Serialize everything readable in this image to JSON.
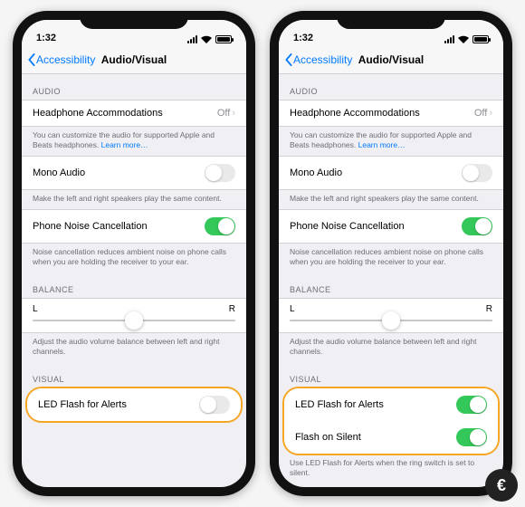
{
  "status": {
    "time": "1:32"
  },
  "nav": {
    "back": "Accessibility",
    "title": "Audio/Visual"
  },
  "sections": {
    "audio_header": "AUDIO",
    "visual_header": "VISUAL",
    "balance_header": "BALANCE"
  },
  "rows": {
    "headphone": {
      "label": "Headphone Accommodations",
      "value": "Off"
    },
    "mono": {
      "label": "Mono Audio"
    },
    "noise": {
      "label": "Phone Noise Cancellation"
    },
    "led": {
      "label": "LED Flash for Alerts"
    },
    "flash_silent": {
      "label": "Flash on Silent"
    }
  },
  "footers": {
    "headphone": "You can customize the audio for supported Apple and Beats headphones. ",
    "headphone_link": "Learn more…",
    "mono": "Make the left and right speakers play the same content.",
    "noise": "Noise cancellation reduces ambient noise on phone calls when you are holding the receiver to your ear.",
    "balance": "Adjust the audio volume balance between left and right channels.",
    "led": "Use LED Flash for Alerts when the ring switch is set to silent."
  },
  "balance": {
    "left": "L",
    "right": "R"
  },
  "toggles": {
    "left": {
      "mono": false,
      "noise": true,
      "led": false
    },
    "right": {
      "mono": false,
      "noise": true,
      "led": true,
      "flash_silent": true
    }
  }
}
